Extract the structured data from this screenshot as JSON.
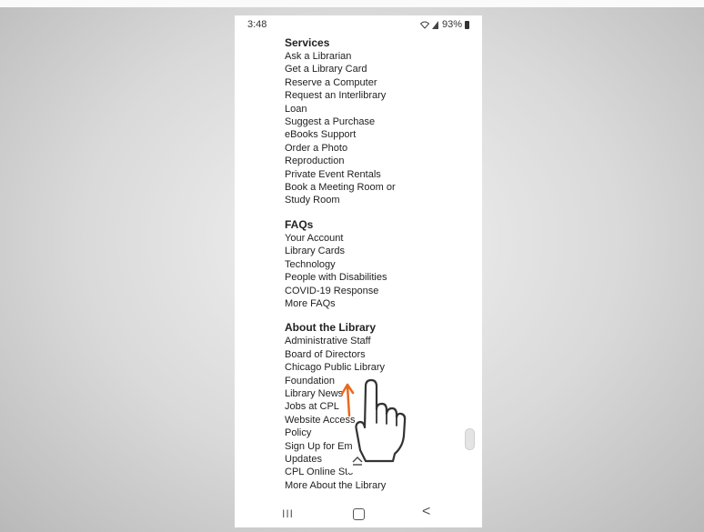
{
  "status_bar": {
    "time": "3:48",
    "battery": "93%"
  },
  "sections": [
    {
      "title": "Services",
      "links": [
        "Ask a Librarian",
        "Get a Library Card",
        "Reserve a Computer",
        "Request an Interlibrary",
        "Loan",
        "Suggest a Purchase",
        "eBooks Support",
        "Order a Photo",
        "Reproduction",
        "Private Event Rentals",
        "Book a Meeting Room or",
        "Study Room"
      ]
    },
    {
      "title": "FAQs",
      "links": [
        "Your Account",
        "Library Cards",
        "Technology",
        "People with Disabilities",
        "COVID-19 Response",
        "More FAQs"
      ]
    },
    {
      "title": "About the Library",
      "links": [
        "Administrative Staff",
        "Board of Directors",
        "Chicago Public Library",
        "Foundation",
        "Library News",
        "Jobs at CPL",
        "Website Access",
        "Policy",
        "Sign Up for Em",
        "Updates",
        "CPL Online Sto",
        "More About the Library"
      ]
    }
  ],
  "nav_bar": {
    "recents": "III",
    "back": "<"
  },
  "icons": [
    "wifi-icon",
    "signal-icon",
    "battery-icon",
    "scroll-to-top-icon",
    "recents-icon",
    "home-icon",
    "back-icon",
    "pointing-hand-icon",
    "swipe-up-arrow-icon"
  ],
  "colors": {
    "arrow": "#e86a1f",
    "page_bg": "#ffffff"
  }
}
